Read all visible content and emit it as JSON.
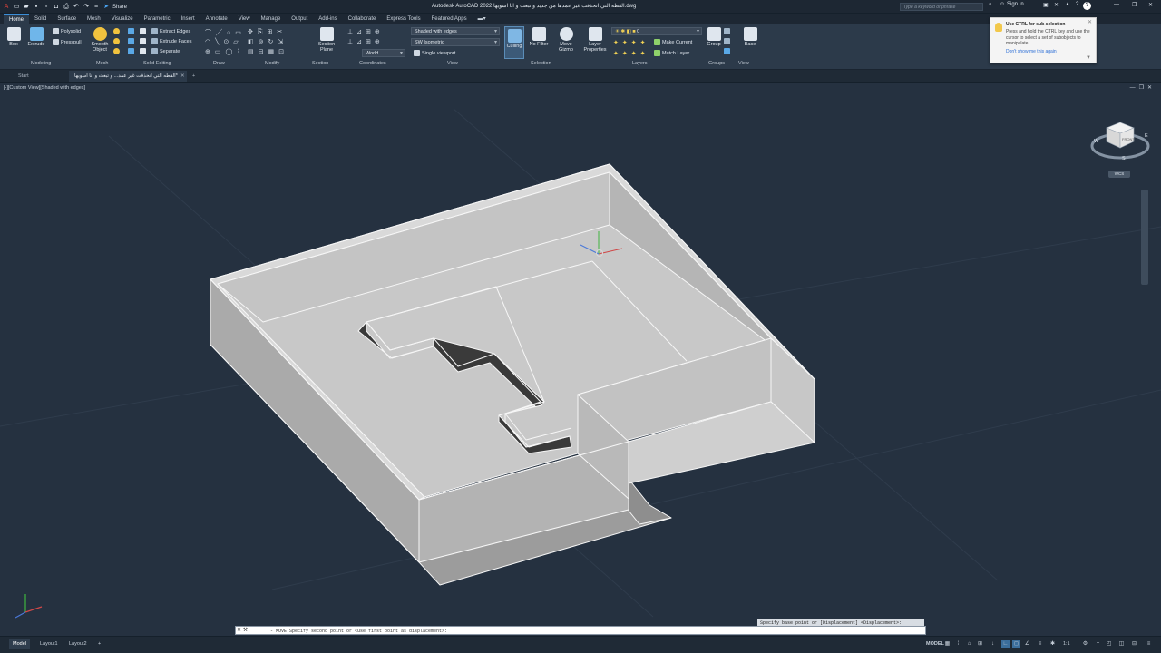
{
  "titlebar": {
    "app_title": "Autodesk AutoCAD 2022   القطه التي انحذفت غير عمدها من جديد و تبعث و انا اسويها.dwg",
    "share_label": "Share",
    "search_placeholder": "Type a keyword or phrase",
    "sign_in": "Sign In"
  },
  "menu_tabs": [
    "Home",
    "Solid",
    "Surface",
    "Mesh",
    "Visualize",
    "Parametric",
    "Insert",
    "Annotate",
    "View",
    "Manage",
    "Output",
    "Add-ins",
    "Collaborate",
    "Express Tools",
    "Featured Apps"
  ],
  "ribbon": {
    "modeling": {
      "box": "Box",
      "extrude": "Extrude",
      "polysolid": "Polysolid",
      "presspull": "Presspull",
      "label": "Modeling"
    },
    "mesh": {
      "smooth_object": "Smooth Object",
      "label": "Mesh"
    },
    "solid_editing": {
      "extract_edges": "Extract Edges",
      "extrude_faces": "Extrude Faces",
      "separate": "Separate",
      "label": "Solid Editing"
    },
    "draw_label": "Draw",
    "modify_label": "Modify",
    "section": {
      "section_plane": "Section Plane",
      "label": "Section"
    },
    "coordinates": {
      "ucs": "World",
      "label": "Coordinates"
    },
    "view": {
      "visual_style": "Shaded with edges",
      "view_preset": "SW Isometric",
      "viewport": "Single viewport",
      "label": "View"
    },
    "selection": {
      "culling": "Culling",
      "no_filter": "No Filter",
      "move_gizmo": "Move Gizmo",
      "label": "Selection"
    },
    "layers": {
      "layer_properties": "Layer Properties",
      "layer_value": "0",
      "make_current": "Make Current",
      "match_layer": "Match Layer",
      "label": "Layers"
    },
    "groups": {
      "group": "Group",
      "label": "Groups"
    },
    "viewgroup": {
      "base": "Base",
      "label": "View"
    }
  },
  "tooltip": {
    "title": "Use CTRL for sub-selection",
    "body": "Press and hold the CTRL key and use the cursor to select a set of subobjects to manipulate.",
    "link": "Don't show me this again"
  },
  "file_tabs": {
    "start": "Start",
    "drawing": "القطه التي انحذفت غير عمد... و تبعث و انا اسويها*"
  },
  "viewport": {
    "label": "[-][Custom View][Shaded with edges]",
    "viewcube_face": "FRONT",
    "compass": {
      "n": "N",
      "w": "W",
      "s": "S",
      "e": "E"
    },
    "wcs": "WCS"
  },
  "command": {
    "prompt": "Specify base point or [Displacement] <Displacement>:",
    "input": "- MOVE Specify second point or <use first point as displacement>:"
  },
  "status": {
    "model_tab": "Model",
    "layout1": "Layout1",
    "layout2": "Layout2",
    "model_space": "MODEL",
    "scale": "1:1"
  },
  "colors": {
    "background": "#253140",
    "ribbon": "#2c3a4a",
    "accent": "#3b8ed8"
  }
}
